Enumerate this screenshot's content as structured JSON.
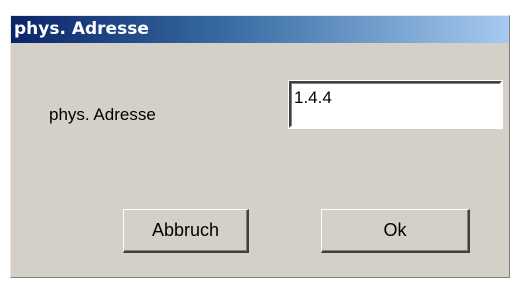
{
  "window": {
    "title": "phys. Adresse"
  },
  "form": {
    "label": "phys. Adresse",
    "value": "1.4.4"
  },
  "buttons": {
    "cancel_label": "Abbruch",
    "ok_label": "Ok"
  },
  "colors": {
    "title_gradient_start": "#0a246a",
    "title_gradient_end": "#a6caf0",
    "dialog_face": "#d4d0c8",
    "input_background": "#ffffff"
  }
}
